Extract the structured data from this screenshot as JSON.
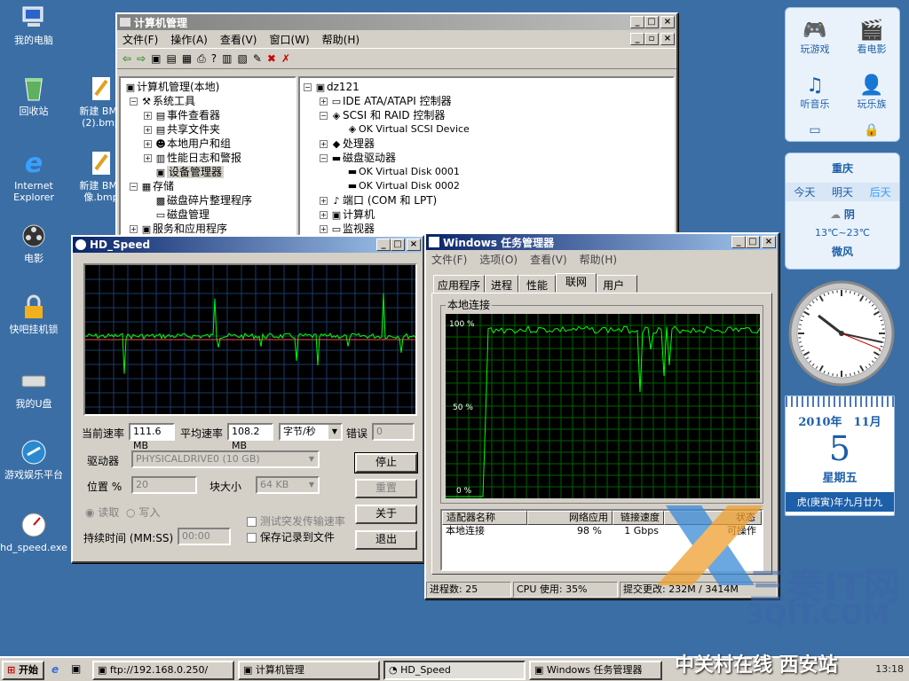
{
  "desktop": {
    "icons": [
      "我的电脑",
      "回收站",
      "新建 BMP (2).bmp",
      "Internet Explorer",
      "新建 BMP 像.bmp",
      "电影",
      "快吧挂机锁",
      "我的U盘",
      "游戏娱乐平台",
      "hd_speed.exe"
    ]
  },
  "compmgmt": {
    "title": "计算机管理",
    "menu": [
      "文件(F)",
      "操作(A)",
      "查看(V)",
      "窗口(W)",
      "帮助(H)"
    ],
    "left": [
      "计算机管理(本地)",
      "系统工具",
      "事件查看器",
      "共享文件夹",
      "本地用户和组",
      "性能日志和警报",
      "设备管理器",
      "存储",
      "磁盘碎片整理程序",
      "磁盘管理",
      "服务和应用程序"
    ],
    "right": [
      "dz121",
      "IDE ATA/ATAPI 控制器",
      "SCSI 和 RAID 控制器",
      "OK Virtual SCSI Device",
      "处理器",
      "磁盘驱动器",
      "OK Virtual Disk 0001",
      "OK Virtual Disk 0002",
      "端口 (COM 和 LPT)",
      "计算机",
      "监视器"
    ]
  },
  "hdspeed": {
    "title": "HD_Speed",
    "cur_label": "当前速率",
    "cur_val": "111.6 MB",
    "avg_label": "平均速率",
    "avg_val": "108.2 MB",
    "unit": "字节/秒",
    "err_label": "错误",
    "err_val": "0",
    "drive_label": "驱动器",
    "drive_val": "PHYSICALDRIVE0 (10 GB)",
    "pos_label": "位置 %",
    "pos_val": "20",
    "block_label": "块大小",
    "block_val": "64 KB",
    "read": "读取",
    "write": "写入",
    "burst": "测试突发传输速率",
    "save": "保存记录到文件",
    "dur_label": "持续时间 (MM:SS)",
    "dur_val": "00:00",
    "btn_stop": "停止",
    "btn_reset": "重置",
    "btn_about": "关于",
    "btn_exit": "退出"
  },
  "taskmgr": {
    "title": "Windows 任务管理器",
    "menu": [
      "文件(F)",
      "选项(O)",
      "查看(V)",
      "帮助(H)"
    ],
    "tabs": [
      "应用程序",
      "进程",
      "性能",
      "联网",
      "用户"
    ],
    "group": "本地连接",
    "y100": "100 %",
    "y50": "50 %",
    "y0": "0 %",
    "cols": [
      "适配器名称",
      "网络应用",
      "链接速度",
      "状态"
    ],
    "row": [
      "本地连接",
      "98 %",
      "1 Gbps",
      "可操作"
    ],
    "status": [
      "进程数: 25",
      "CPU 使用: 35%",
      "提交更改: 232M / 3414M"
    ]
  },
  "sidebar": {
    "buttons": [
      "玩游戏",
      "看电影",
      "听音乐",
      "玩乐族"
    ],
    "weather": {
      "city": "重庆",
      "days": [
        "今天",
        "明天",
        "后天"
      ],
      "cond": "阴",
      "temp": "13℃~23℃",
      "wind": "微风"
    },
    "calendar": {
      "yearmonth": "2010年　11月",
      "day": "5",
      "weekday": "星期五",
      "lunar": "虎(庚寅)年九月廿九"
    }
  },
  "taskbar": {
    "start": "开始",
    "items": [
      "ftp://192.168.0.250/",
      "计算机管理",
      "HD_Speed",
      "Windows 任务管理器"
    ],
    "clock": "13:18"
  },
  "watermark": {
    "brand": "三秦IT网",
    "url": "3QIT.COM",
    "banner": "中关村在线 西安站"
  },
  "colors": {
    "desktop": "#3a6ea5",
    "titlebar": "#0a246a",
    "graph": "#00ff00",
    "graphbg": "#000000"
  }
}
